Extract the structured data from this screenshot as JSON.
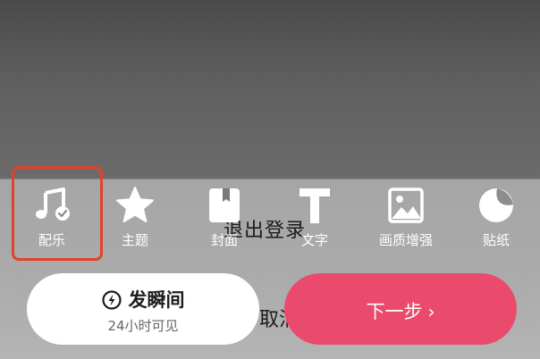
{
  "overlay": {
    "logout_text": "退出登录",
    "cancel_text": "取消"
  },
  "toolbar": {
    "items": [
      {
        "label": "配乐",
        "icon": "music-note-check-icon"
      },
      {
        "label": "主题",
        "icon": "star-icon"
      },
      {
        "label": "封面",
        "icon": "book-icon"
      },
      {
        "label": "文字",
        "icon": "text-t-icon"
      },
      {
        "label": "画质增强",
        "icon": "image-icon"
      },
      {
        "label": "贴纸",
        "icon": "sticker-icon"
      }
    ]
  },
  "moment_button": {
    "label": "发瞬间",
    "sublabel": "24小时可见",
    "icon": "bolt-circle-icon"
  },
  "next_button": {
    "label": "下一步",
    "chevron": "›"
  },
  "colors": {
    "accent": "#ea4b6c",
    "highlight": "#e2412f"
  }
}
